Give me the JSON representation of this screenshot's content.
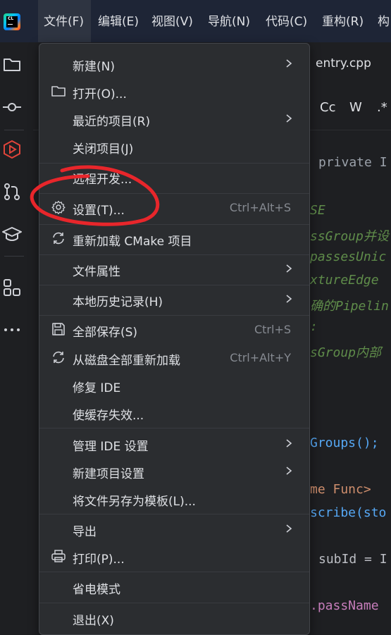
{
  "menubar": {
    "items": [
      {
        "label": "文件(F)"
      },
      {
        "label": "编辑(E)"
      },
      {
        "label": "视图(V)"
      },
      {
        "label": "导航(N)"
      },
      {
        "label": "代码(C)"
      },
      {
        "label": "重构(R)"
      },
      {
        "label": "构"
      }
    ],
    "logo_text": "CL"
  },
  "editor": {
    "tab_label": "entry.cpp",
    "find_options": [
      "Cc",
      "W",
      ".*"
    ],
    "code_lines": [
      {
        "text": "private I",
        "style": "kw"
      },
      {
        "text": "SE",
        "style": "cm"
      },
      {
        "text": "ssGroup并设",
        "style": "cm"
      },
      {
        "text": "passesUnic",
        "style": "cm"
      },
      {
        "text": "xtureEdge",
        "style": "cm"
      },
      {
        "text": "确的Pipelin",
        "style": "cm"
      },
      {
        "text": ":",
        "style": "cm"
      },
      {
        "text": "sGroup内部",
        "style": "cm"
      },
      {
        "text": "Groups();",
        "style": "fn"
      },
      {
        "text": "me Func>",
        "style": "kw2"
      },
      {
        "text": "scribe(sto",
        "style": "fn"
      },
      {
        "text": "subId = I",
        "style": "wh"
      },
      {
        "text": ".passName",
        "style": "pp"
      }
    ]
  },
  "file_menu": {
    "items": [
      {
        "label": "新建(N)",
        "submenu": true,
        "icon": ""
      },
      {
        "label": "打开(O)...",
        "icon": "folder-icon"
      },
      {
        "label": "最近的项目(R)",
        "submenu": true,
        "icon": ""
      },
      {
        "label": "关闭项目(J)",
        "icon": ""
      },
      {
        "label": "远程开发...",
        "icon": ""
      },
      {
        "label": "设置(T)...",
        "shortcut": "Ctrl+Alt+S",
        "icon": "gear-icon"
      },
      {
        "label": "重新加载 CMake 项目",
        "icon": "reload-icon"
      },
      {
        "label": "文件属性",
        "submenu": true,
        "icon": ""
      },
      {
        "label": "本地历史记录(H)",
        "submenu": true,
        "icon": ""
      },
      {
        "label": "全部保存(S)",
        "shortcut": "Ctrl+S",
        "icon": "save-icon"
      },
      {
        "label": "从磁盘全部重新加载",
        "shortcut": "Ctrl+Alt+Y",
        "icon": "reload-icon"
      },
      {
        "label": "修复 IDE",
        "icon": ""
      },
      {
        "label": "使缓存失效...",
        "icon": ""
      },
      {
        "label": "管理 IDE 设置",
        "submenu": true,
        "icon": ""
      },
      {
        "label": "新建项目设置",
        "submenu": true,
        "icon": ""
      },
      {
        "label": "将文件另存为模板(L)...",
        "icon": ""
      },
      {
        "label": "导出",
        "submenu": true,
        "icon": ""
      },
      {
        "label": "打印(P)...",
        "icon": "print-icon"
      },
      {
        "label": "省电模式",
        "icon": ""
      },
      {
        "label": "退出(X)",
        "icon": ""
      }
    ]
  },
  "colors": {
    "menubar_bg": "#1e2536",
    "menu_bg": "#2b2d30",
    "annotation": "#e8262b"
  }
}
